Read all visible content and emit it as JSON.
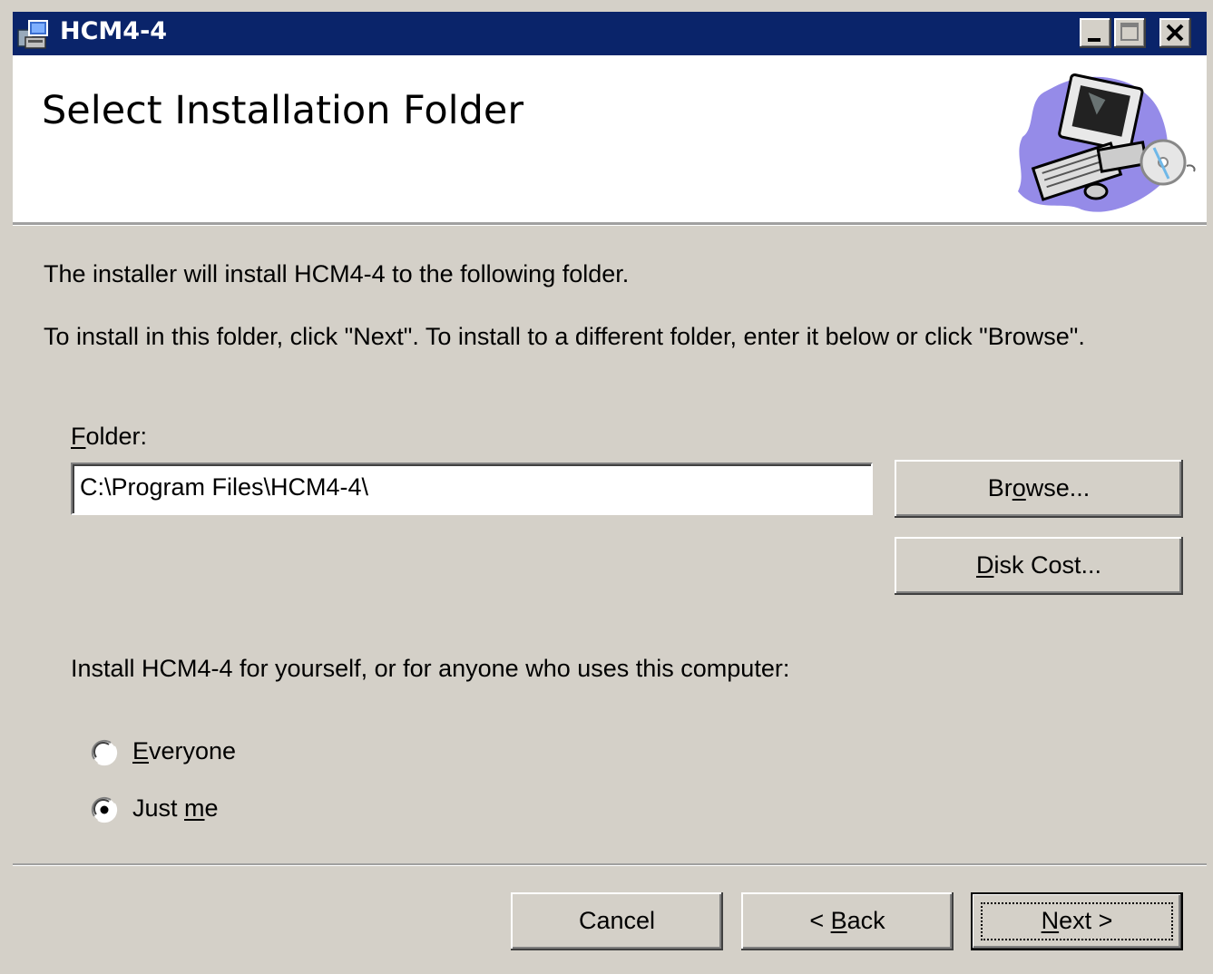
{
  "window": {
    "title": "HCM4-4"
  },
  "header": {
    "title": "Select Installation Folder"
  },
  "body": {
    "intro_line1": "The installer will install HCM4-4 to the following folder.",
    "intro_line2": "To install in this folder, click \"Next\". To install to a different folder, enter it below or click \"Browse\".",
    "folder_label_mnemonic": "F",
    "folder_label_rest": "older:",
    "folder_value": "C:\\Program Files\\HCM4-4\\",
    "browse_pre": "Br",
    "browse_mnemonic": "o",
    "browse_post": "wse...",
    "diskcost_mnemonic": "D",
    "diskcost_post": "isk Cost...",
    "install_for_text": "Install HCM4-4 for yourself, or for anyone who uses this computer:",
    "radio_everyone_mnemonic": "E",
    "radio_everyone_rest": "veryone",
    "radio_everyone_checked": false,
    "radio_justme_pre": "Just ",
    "radio_justme_mnemonic": "m",
    "radio_justme_post": "e",
    "radio_justme_checked": true
  },
  "footer": {
    "cancel": "Cancel",
    "back_pre": "< ",
    "back_mnemonic": "B",
    "back_post": "ack",
    "next_mnemonic": "N",
    "next_post": "ext >"
  },
  "icons": {
    "app": "installer-icon",
    "banner": "computer-with-cd-icon",
    "minimize": "minimize-icon",
    "maximize": "maximize-icon",
    "close": "close-icon"
  },
  "colors": {
    "titlebar": "#0a246a",
    "face": "#d4d0c8",
    "header_bg": "#ffffff"
  }
}
